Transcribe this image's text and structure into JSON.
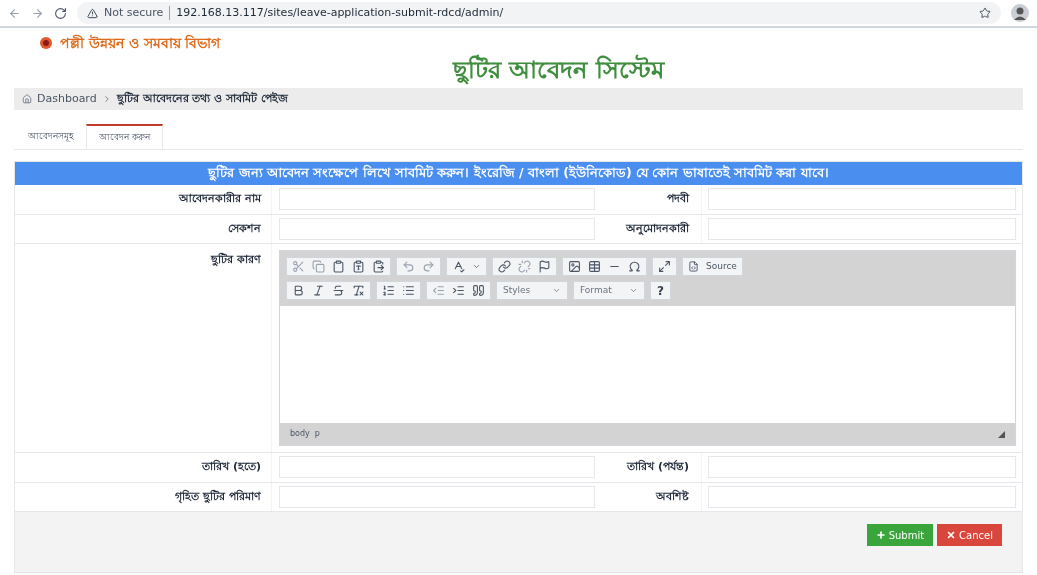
{
  "browser": {
    "security": "Not secure",
    "url": "192.168.13.117/sites/leave-application-submit-rdcd/admin/"
  },
  "header": {
    "org": "পল্লী উন্নয়ন ও সমবায় বিভাগ",
    "title": "ছুটির আবেদন সিস্টেম"
  },
  "breadcrumb": [
    {
      "label": "Dashboard"
    },
    {
      "label": "ছুটির আবেদনের তথ্য ও সাবমিট পেইজ"
    }
  ],
  "tabs": [
    {
      "label": "আবেদনসমূহ",
      "selected": false
    },
    {
      "label": "আবেদন করুন",
      "selected": true
    }
  ],
  "form": {
    "banner": "ছুটির জন্য আবেদন সংক্ষেপে লিখে সাবমিট করুন। ইংরেজি / বাংলা (ইউনিকোড) যে কোন ভাষাতেই সাবমিট করা যাবে।",
    "rows": [
      {
        "kind": "pair",
        "fields": [
          {
            "label": "আবেদনকারীর নাম"
          },
          {
            "label": "পদবী"
          }
        ]
      },
      {
        "kind": "pair",
        "fields": [
          {
            "label": "সেকশন"
          },
          {
            "label": "অনুমোদনকারী"
          }
        ]
      },
      {
        "kind": "editor",
        "fields": [
          {
            "label": "ছুটির কারণ"
          }
        ]
      },
      {
        "kind": "pair",
        "fields": [
          {
            "label": "তারিখ (হতে)"
          },
          {
            "label": "তারিখ (পর্যন্ত)"
          }
        ]
      },
      {
        "kind": "pair",
        "fields": [
          {
            "label": "গৃহিত ছুটির পরিমাণ"
          },
          {
            "label": "অবশিষ্ট"
          }
        ]
      }
    ],
    "editor": {
      "source": "Source",
      "styles": "Styles",
      "format": "Format",
      "help": "?",
      "path": "body  p"
    },
    "buttons": [
      {
        "kind": "submit",
        "label": "Submit"
      },
      {
        "kind": "cancel",
        "label": "Cancel"
      }
    ]
  }
}
